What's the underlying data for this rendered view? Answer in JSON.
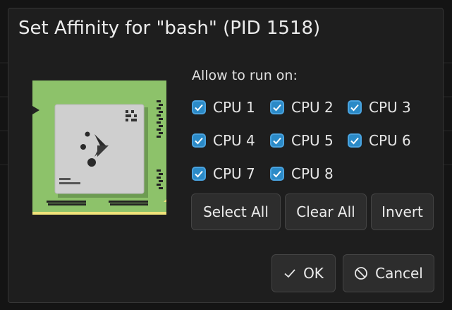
{
  "dialog": {
    "title": "Set Affinity for \"bash\" (PID 1518)",
    "allow_label": "Allow to run on:",
    "icon": "cpu-chip-icon"
  },
  "cpus": [
    {
      "label": "CPU 1",
      "checked": true
    },
    {
      "label": "CPU 2",
      "checked": true
    },
    {
      "label": "CPU 3",
      "checked": true
    },
    {
      "label": "CPU 4",
      "checked": true
    },
    {
      "label": "CPU 5",
      "checked": true
    },
    {
      "label": "CPU 6",
      "checked": true
    },
    {
      "label": "CPU 7",
      "checked": true
    },
    {
      "label": "CPU 8",
      "checked": true
    }
  ],
  "buttons": {
    "select_all": "Select All",
    "clear_all": "Clear All",
    "invert": "Invert",
    "ok": "OK",
    "cancel": "Cancel"
  },
  "colors": {
    "accent": "#2b8ac7",
    "chip_green": "#8dc26a",
    "background": "#1e1e1e"
  }
}
